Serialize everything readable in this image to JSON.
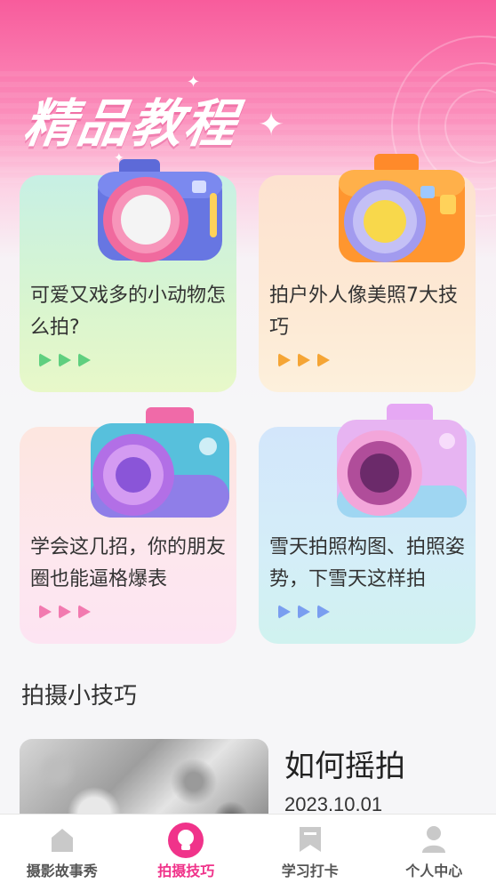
{
  "header": {
    "title": "精品教程"
  },
  "cards": [
    {
      "title": "可爱又戏多的小动物怎么拍?",
      "icon": "camera-icon",
      "bg": "#ccf3dd",
      "play_color": "#5fcf7f"
    },
    {
      "title": "拍户外人像美照7大技巧",
      "icon": "camera-icon",
      "bg": "#fde6d2",
      "play_color": "#f5a535"
    },
    {
      "title": "学会这几招，你的朋友圈也能逼格爆表",
      "icon": "camera-icon",
      "bg": "#fde6ec",
      "play_color": "#f27ab0"
    },
    {
      "title": "雪天拍照构图、拍照姿势，下雪天这样拍",
      "icon": "camera-icon",
      "bg": "#d6ecfb",
      "play_color": "#7a9ef0"
    }
  ],
  "tips": {
    "section_title": "拍摄小技巧",
    "items": [
      {
        "title": "如何摇拍",
        "date": "2023.10.01"
      }
    ]
  },
  "tabbar": {
    "items": [
      {
        "label": "摄影故事秀",
        "icon": "home-icon",
        "active": false
      },
      {
        "label": "拍摄技巧",
        "icon": "lightbulb-icon",
        "active": true
      },
      {
        "label": "学习打卡",
        "icon": "bookmark-icon",
        "active": false
      },
      {
        "label": "个人中心",
        "icon": "user-icon",
        "active": false
      }
    ]
  },
  "colors": {
    "accent": "#f0338a",
    "hero_top": "#f85c9c"
  }
}
